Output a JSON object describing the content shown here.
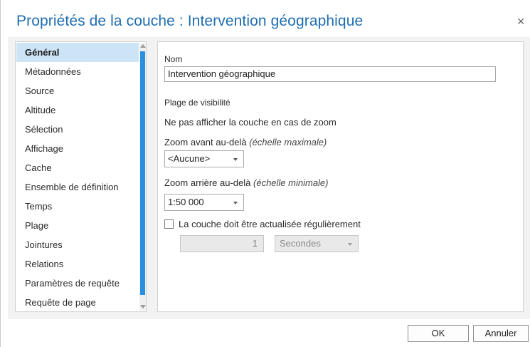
{
  "dialog": {
    "title": "Propriétés de la couche : Intervention géographique",
    "close_glyph": "×"
  },
  "nav": {
    "selected": "Général",
    "items": [
      {
        "label": "Général"
      },
      {
        "label": "Métadonnées"
      },
      {
        "label": "Source"
      },
      {
        "label": "Altitude"
      },
      {
        "label": "Sélection"
      },
      {
        "label": "Affichage"
      },
      {
        "label": "Cache"
      },
      {
        "label": "Ensemble de définition"
      },
      {
        "label": "Temps"
      },
      {
        "label": "Plage"
      },
      {
        "label": "Jointures"
      },
      {
        "label": "Relations"
      },
      {
        "label": "Paramètres de requête"
      },
      {
        "label": "Requête de page"
      }
    ]
  },
  "general": {
    "name_label": "Nom",
    "name_value": "Intervention géographique",
    "visibility_heading": "Plage de visibilité",
    "visibility_desc": "Ne pas afficher la couche en cas de zoom",
    "zoom_in_label": "Zoom avant au-delà",
    "zoom_in_hint": "(échelle maximale)",
    "zoom_in_value": "<Aucune>",
    "zoom_out_label": "Zoom arrière au-delà",
    "zoom_out_hint": "(échelle minimale)",
    "zoom_out_value": "1:50 000",
    "refresh_label": "La couche doit être actualisée régulièrement",
    "refresh_checked": false,
    "refresh_interval": "1",
    "refresh_unit": "Secondes"
  },
  "buttons": {
    "ok": "OK",
    "cancel": "Annuler"
  },
  "colors": {
    "title": "#1f6db2",
    "selected_item": "#cde4f7",
    "scroll_thumb": "#2b8fe0"
  }
}
